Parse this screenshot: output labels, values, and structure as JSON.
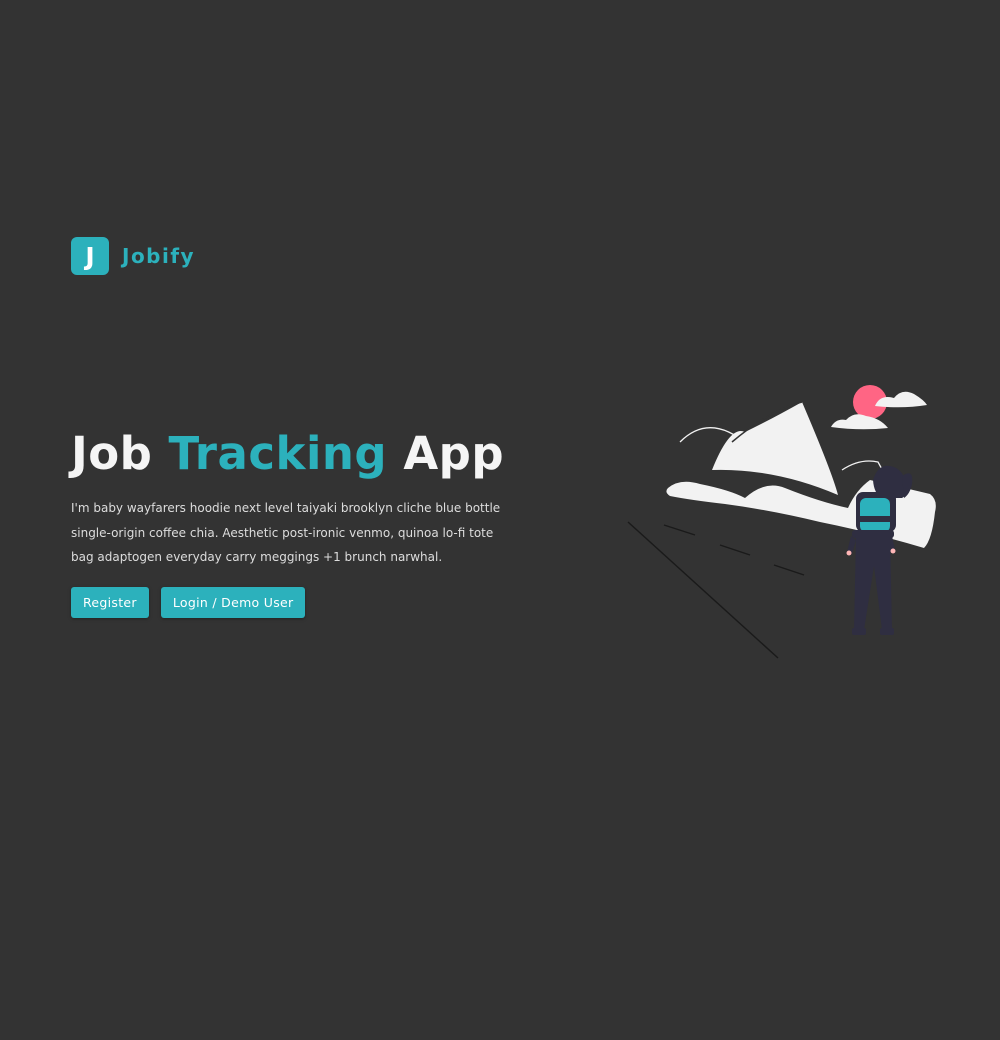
{
  "logo": {
    "mark": "J",
    "name": "Jobify"
  },
  "hero": {
    "title_part1": "Job",
    "title_accent": "Tracking",
    "title_part2": "App",
    "description": "I'm baby wayfarers hoodie next level taiyaki brooklyn cliche blue bottle single-origin coffee chia. Aesthetic post-ironic venmo, quinoa lo-fi tote bag adaptogen everyday carry meggings +1 brunch narwhal."
  },
  "buttons": {
    "register": "Register",
    "login": "Login / Demo User"
  },
  "illustration": {
    "icon": "hiker-mountains-illustration"
  },
  "colors": {
    "background": "#333333",
    "primary": "#2cb1bc",
    "sun": "#ff6584",
    "text": "#f5f5f5"
  }
}
